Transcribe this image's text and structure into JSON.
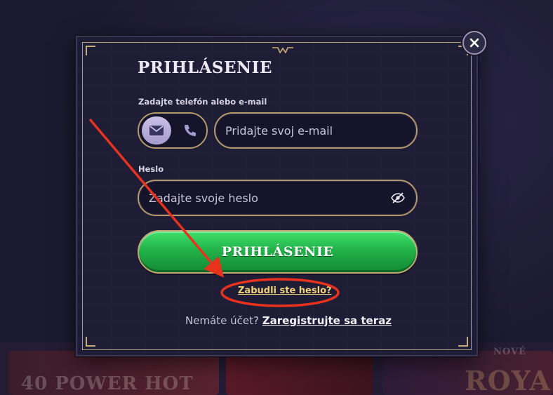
{
  "modal": {
    "title": "PRIHLÁSENIE",
    "close_icon": "close-icon"
  },
  "login_form": {
    "email_label": "Zadajte telefón alebo e-mail",
    "method_toggle": {
      "options": [
        {
          "icon": "envelope-icon",
          "selected": true
        },
        {
          "icon": "phone-icon",
          "selected": false
        }
      ]
    },
    "email_placeholder": "Pridajte svoj e-mail",
    "email_value": "",
    "password_label": "Heslo",
    "password_placeholder": "Zadajte svoje heslo",
    "password_value": "",
    "visibility_icon": "eye-slash-icon",
    "submit_label": "PRIHLÁSENIE",
    "forgot_password": "Zabudli ste heslo?",
    "register_prompt": "Nemáte účet?",
    "register_link": "Zaregistrujte sa teraz"
  },
  "background": {
    "tiles": [
      {
        "label": "40 POWER HOT"
      },
      {
        "label": "NOVÉ"
      },
      {
        "label": "ROYA"
      }
    ]
  },
  "colors": {
    "accent_gold": "#b39a6c",
    "submit_green": "#22b24a",
    "link_yellow": "#f1d27a",
    "annotation_red": "#e8321e"
  }
}
